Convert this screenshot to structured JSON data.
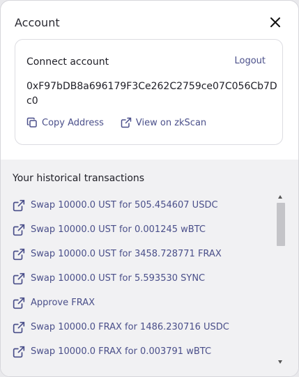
{
  "modal": {
    "title": "Account"
  },
  "account": {
    "connect_label": "Connect account",
    "logout_label": "Logout",
    "address": "0xF97bDB8a696179F3Ce262C2759ce07C056Cb7Dc0",
    "copy_label": "Copy Address",
    "zkscan_label": "View on zkScan"
  },
  "history": {
    "title": "Your historical transactions",
    "transactions": [
      "Swap 10000.0 UST for 505.454607 USDC",
      "Swap 10000.0 UST for 0.001245 wBTC",
      "Swap 10000.0 UST for 3458.728771 FRAX",
      "Swap 10000.0 UST for 5.593530 SYNC",
      "Approve FRAX",
      "Swap 10000.0 FRAX for 1486.230716 USDC",
      "Swap 10000.0 FRAX for 0.003791 wBTC"
    ]
  },
  "colors": {
    "link": "#4a4f8a",
    "text": "#202028",
    "history_bg": "#f1f1f3"
  }
}
